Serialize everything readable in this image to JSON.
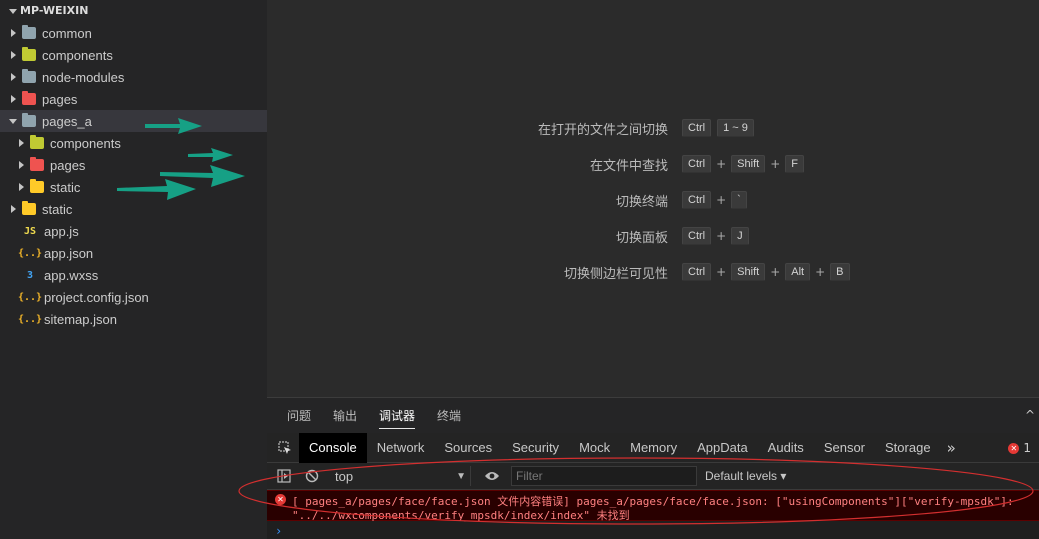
{
  "sidebar": {
    "project_name": "MP-WEIXIN",
    "items": [
      {
        "label": "common",
        "type": "folder",
        "color": "#90a4ae",
        "depth": 0,
        "expanded": false
      },
      {
        "label": "components",
        "type": "folder",
        "color": "#c0ca33",
        "depth": 0,
        "expanded": false
      },
      {
        "label": "node-modules",
        "type": "folder",
        "color": "#90a4ae",
        "depth": 0,
        "expanded": false
      },
      {
        "label": "pages",
        "type": "folder",
        "color": "#ef5350",
        "depth": 0,
        "expanded": false
      },
      {
        "label": "pages_a",
        "type": "folder",
        "color": "#90a4ae",
        "depth": 0,
        "expanded": true
      },
      {
        "label": "components",
        "type": "folder",
        "color": "#c0ca33",
        "depth": 1,
        "expanded": false
      },
      {
        "label": "pages",
        "type": "folder",
        "color": "#ef5350",
        "depth": 1,
        "expanded": false
      },
      {
        "label": "static",
        "type": "folder",
        "color": "#ffca28",
        "depth": 1,
        "expanded": false
      },
      {
        "label": "static",
        "type": "folder",
        "color": "#ffca28",
        "depth": 0,
        "expanded": false
      },
      {
        "label": "app.js",
        "type": "file",
        "icon_text": "JS",
        "color": "#f0db4f",
        "depth": 0
      },
      {
        "label": "app.json",
        "type": "file",
        "icon_text": "{..}",
        "color": "#f0b429",
        "depth": 0
      },
      {
        "label": "app.wxss",
        "type": "file",
        "icon_text": "3",
        "color": "#42a5f5",
        "depth": 0
      },
      {
        "label": "project.config.json",
        "type": "file",
        "icon_text": "{..}",
        "color": "#f0b429",
        "depth": 0
      },
      {
        "label": "sitemap.json",
        "type": "file",
        "icon_text": "{..}",
        "color": "#f0b429",
        "depth": 0
      }
    ]
  },
  "shortcuts": [
    {
      "action": "在打开的文件之间切换",
      "keys": [
        "Ctrl",
        "1 ~ 9"
      ],
      "joined": false
    },
    {
      "action": "在文件中查找",
      "keys": [
        "Ctrl",
        "Shift",
        "F"
      ],
      "joined": true
    },
    {
      "action": "切换终端",
      "keys": [
        "Ctrl",
        "`"
      ],
      "joined": true
    },
    {
      "action": "切换面板",
      "keys": [
        "Ctrl",
        "J"
      ],
      "joined": true
    },
    {
      "action": "切换侧边栏可见性",
      "keys": [
        "Ctrl",
        "Shift",
        "Alt",
        "B"
      ],
      "joined": true
    }
  ],
  "panel": {
    "tabs": [
      "问题",
      "输出",
      "调试器",
      "终端"
    ],
    "active_tab": "调试器"
  },
  "devtools": {
    "tabs": [
      "Console",
      "Network",
      "Sources",
      "Security",
      "Mock",
      "Memory",
      "AppData",
      "Audits",
      "Sensor",
      "Storage"
    ],
    "active_tab": "Console",
    "more_label": "»",
    "error_count": "1"
  },
  "console": {
    "context": "top",
    "filter_placeholder": "Filter",
    "levels_label": "Default levels ▾",
    "error_line1": "[ pages_a/pages/face/face.json 文件内容错误] pages_a/pages/face/face.json: [\"usingComponents\"][\"verify-mpsdk\"]:",
    "error_line2": "\"../../wxcomponents/verify_mpsdk/index/index\" 未找到",
    "prompt": "›"
  },
  "colors": {
    "accent_annotation": "#16a085",
    "error": "#ff8080",
    "annotation_ellipse": "#d32f2f"
  }
}
